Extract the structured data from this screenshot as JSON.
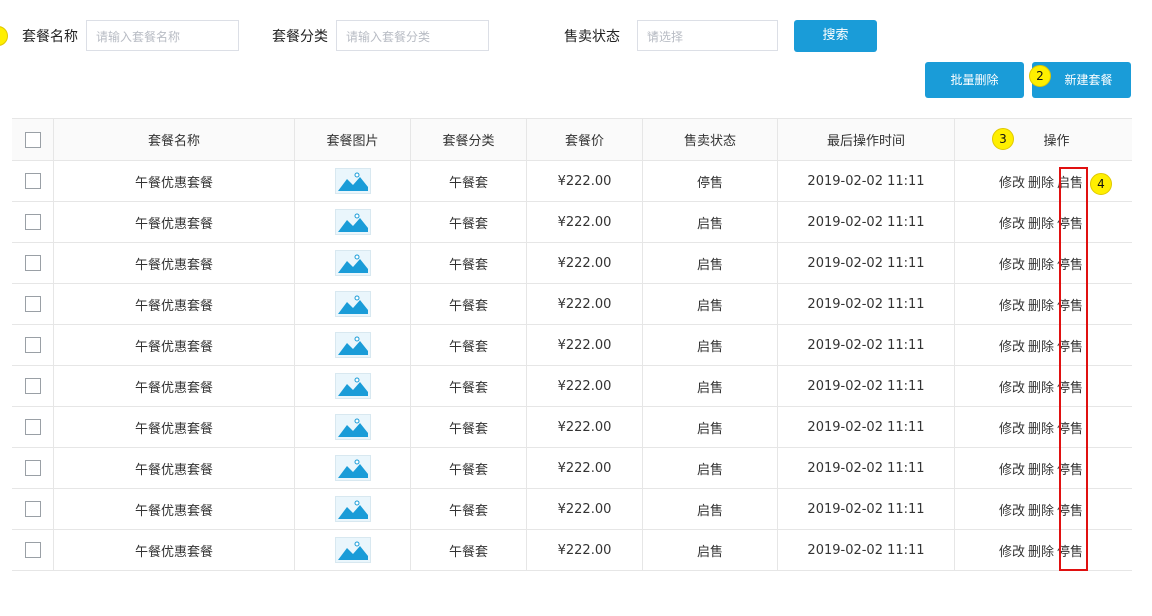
{
  "search": {
    "name_label": "套餐名称",
    "name_placeholder": "请输入套餐名称",
    "category_label": "套餐分类",
    "category_placeholder": "请输入套餐分类",
    "status_label": "售卖状态",
    "status_placeholder": "请选择",
    "search_button": "搜索"
  },
  "toolbar": {
    "batch_delete": "批量删除",
    "new_package": "新建套餐"
  },
  "badges": {
    "b2": "2",
    "b3": "3",
    "b4": "4"
  },
  "table": {
    "headers": [
      "套餐名称",
      "套餐图片",
      "套餐分类",
      "套餐价",
      "售卖状态",
      "最后操作时间",
      "操作"
    ],
    "rows": [
      {
        "name": "午餐优惠套餐",
        "category": "午餐套",
        "price": "¥222.00",
        "status": "停售",
        "time": "2019-02-02 11:11",
        "edit": "修改",
        "delete": "删除",
        "toggle": "启售"
      },
      {
        "name": "午餐优惠套餐",
        "category": "午餐套",
        "price": "¥222.00",
        "status": "启售",
        "time": "2019-02-02 11:11",
        "edit": "修改",
        "delete": "删除",
        "toggle": "停售"
      },
      {
        "name": "午餐优惠套餐",
        "category": "午餐套",
        "price": "¥222.00",
        "status": "启售",
        "time": "2019-02-02 11:11",
        "edit": "修改",
        "delete": "删除",
        "toggle": "停售"
      },
      {
        "name": "午餐优惠套餐",
        "category": "午餐套",
        "price": "¥222.00",
        "status": "启售",
        "time": "2019-02-02 11:11",
        "edit": "修改",
        "delete": "删除",
        "toggle": "停售"
      },
      {
        "name": "午餐优惠套餐",
        "category": "午餐套",
        "price": "¥222.00",
        "status": "启售",
        "time": "2019-02-02 11:11",
        "edit": "修改",
        "delete": "删除",
        "toggle": "停售"
      },
      {
        "name": "午餐优惠套餐",
        "category": "午餐套",
        "price": "¥222.00",
        "status": "启售",
        "time": "2019-02-02 11:11",
        "edit": "修改",
        "delete": "删除",
        "toggle": "停售"
      },
      {
        "name": "午餐优惠套餐",
        "category": "午餐套",
        "price": "¥222.00",
        "status": "启售",
        "time": "2019-02-02 11:11",
        "edit": "修改",
        "delete": "删除",
        "toggle": "停售"
      },
      {
        "name": "午餐优惠套餐",
        "category": "午餐套",
        "price": "¥222.00",
        "status": "启售",
        "time": "2019-02-02 11:11",
        "edit": "修改",
        "delete": "删除",
        "toggle": "停售"
      },
      {
        "name": "午餐优惠套餐",
        "category": "午餐套",
        "price": "¥222.00",
        "status": "启售",
        "time": "2019-02-02 11:11",
        "edit": "修改",
        "delete": "删除",
        "toggle": "停售"
      },
      {
        "name": "午餐优惠套餐",
        "category": "午餐套",
        "price": "¥222.00",
        "status": "启售",
        "time": "2019-02-02 11:11",
        "edit": "修改",
        "delete": "删除",
        "toggle": "停售"
      }
    ]
  },
  "colors": {
    "accent": "#1a9cd8",
    "badge": "#ffef00",
    "highlight": "#e01010"
  }
}
